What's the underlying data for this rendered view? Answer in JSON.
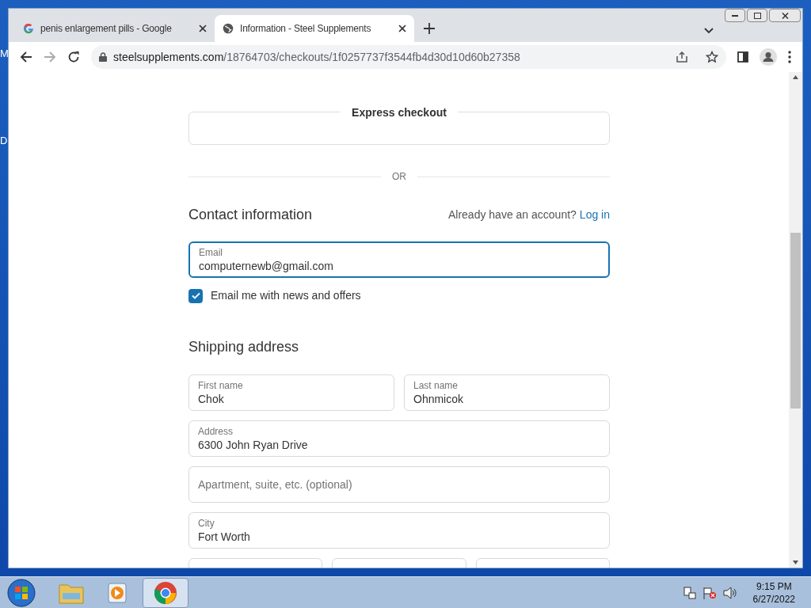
{
  "desktop": {
    "icon_labels": [
      "M",
      "D"
    ]
  },
  "browser": {
    "tabs": [
      {
        "title": "penis enlargement pills - Google",
        "selected": false,
        "kind": "google"
      },
      {
        "title": "Information - Steel Supplements",
        "selected": true,
        "kind": "globe"
      }
    ],
    "url_domain": "steelsupplements.com",
    "url_path": "/18764703/checkouts/1f0257737f3544fb4d30d10d60b27358"
  },
  "page": {
    "express_checkout": "Express checkout",
    "divider": "OR",
    "contact_title": "Contact information",
    "account_prompt": "Already have an account?",
    "login_link": "Log in",
    "email": {
      "kind": "filled",
      "label": "Email",
      "value": "computernewb@gmail.com",
      "focused": true
    },
    "newsletter": {
      "label": "Email me with news and offers",
      "checked": true
    },
    "shipping_title": "Shipping address",
    "fields": [
      [
        {
          "kind": "filled",
          "label": "First name",
          "value": "Chok"
        },
        {
          "kind": "filled",
          "label": "Last name",
          "value": "Ohnmicok"
        }
      ],
      [
        {
          "kind": "filled",
          "label": "Address",
          "value": "6300 John Ryan Drive"
        }
      ],
      [
        {
          "kind": "empty",
          "placeholder": "Apartment, suite, etc. (optional)"
        }
      ],
      [
        {
          "kind": "filled",
          "label": "City",
          "value": "Fort Worth"
        }
      ],
      [
        {
          "kind": "cut"
        },
        {
          "kind": "cut"
        },
        {
          "kind": "cut"
        }
      ]
    ]
  },
  "taskbar": {
    "time": "9:15 PM",
    "date": "6/27/2022"
  }
}
